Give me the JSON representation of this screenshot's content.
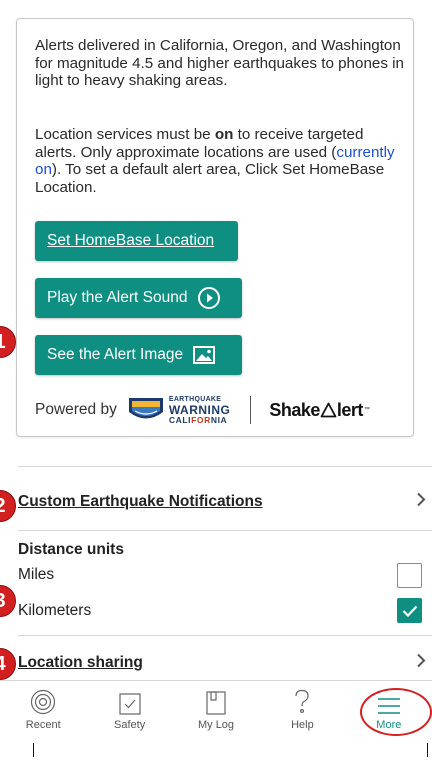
{
  "card": {
    "para1": "Alerts delivered in California, Oregon, and Washington for magnitude 4.5 and higher earthquakes to phones in light to heavy shaking areas.",
    "para2_a": "Location services must be ",
    "para2_bold": "on",
    "para2_b": " to receive targeted alerts. Only approximate locations are used (",
    "para2_link": "currently on",
    "para2_c": "). To set a default alert area, Click Set HomeBase Location.",
    "btn_homebase": "Set HomeBase Location",
    "btn_sound": "Play the Alert Sound",
    "btn_image": "See the Alert Image",
    "powered_by": "Powered by",
    "ewc_line1": "EARTHQUAKE",
    "ewc_line2": "WARNING",
    "ewc_line3a": "CALI",
    "ewc_line3b": "FOR",
    "ewc_line3c": "NIA",
    "shake_a": "Shake",
    "shake_b": "lert",
    "shake_tm": "™"
  },
  "rows": {
    "custom_notifications": "Custom Earthquake Notifications",
    "distance_units": "Distance units",
    "miles": "Miles",
    "kilometers": "Kilometers",
    "location_sharing": "Location sharing"
  },
  "units_state": {
    "miles": false,
    "kilometers": true
  },
  "nav": [
    {
      "label": "Recent",
      "icon": "target-icon"
    },
    {
      "label": "Safety",
      "icon": "checkbox-icon"
    },
    {
      "label": "My Log",
      "icon": "book-icon"
    },
    {
      "label": "Help",
      "icon": "question-icon"
    },
    {
      "label": "More",
      "icon": "menu-icon"
    }
  ],
  "badges": [
    "1",
    "2",
    "3",
    "4"
  ],
  "colors": {
    "accent": "#0e8f82",
    "callout": "#d21f1f",
    "link": "#1a4fd1"
  }
}
